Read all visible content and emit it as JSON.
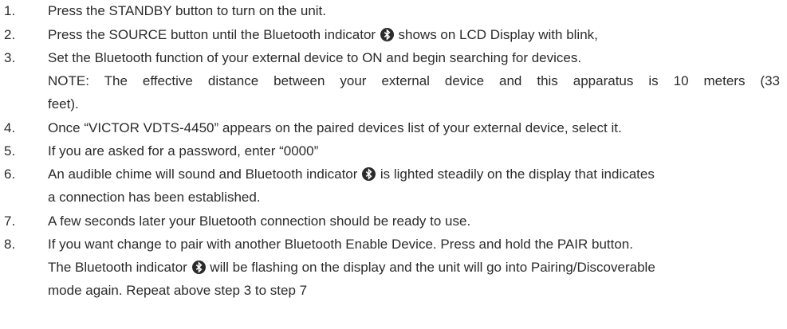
{
  "steps": [
    {
      "num": "1.",
      "text": "Press the STANDBY button to turn on the unit."
    },
    {
      "num": "2.",
      "before_icon": "Press the SOURCE button until the Bluetooth indicator ",
      "after_icon": " shows on LCD Display with blink,"
    },
    {
      "num": "3.",
      "text": "Set the Bluetooth function of your external device to ON and begin searching for devices.",
      "note_line1": "NOTE: The effective distance between your external device and this apparatus is 10 meters (33",
      "note_line2": "feet)."
    },
    {
      "num": "4.",
      "text": "Once “VICTOR VDTS-4450” appears on the paired devices list of your external device, select it."
    },
    {
      "num": "5.",
      "text": "If you are asked for a password, enter “0000”"
    },
    {
      "num": "6.",
      "before_icon": "An audible chime will sound and Bluetooth indicator ",
      "after_icon": " is lighted steadily on the display that indicates",
      "line2": "a connection has been established."
    },
    {
      "num": "7.",
      "text": "A few seconds later your Bluetooth connection should be ready to use."
    },
    {
      "num": "8.",
      "text": "If you want change to pair with another Bluetooth Enable Device. Press and hold the PAIR button.",
      "line2_before_icon": "The Bluetooth indicator ",
      "line2_after_icon": " will be flashing on the display and the unit will go into Pairing/Discoverable",
      "line3": "mode again. Repeat above step 3 to step 7"
    }
  ],
  "icon": {
    "name": "bluetooth-icon",
    "color": "#2b2b2b"
  }
}
